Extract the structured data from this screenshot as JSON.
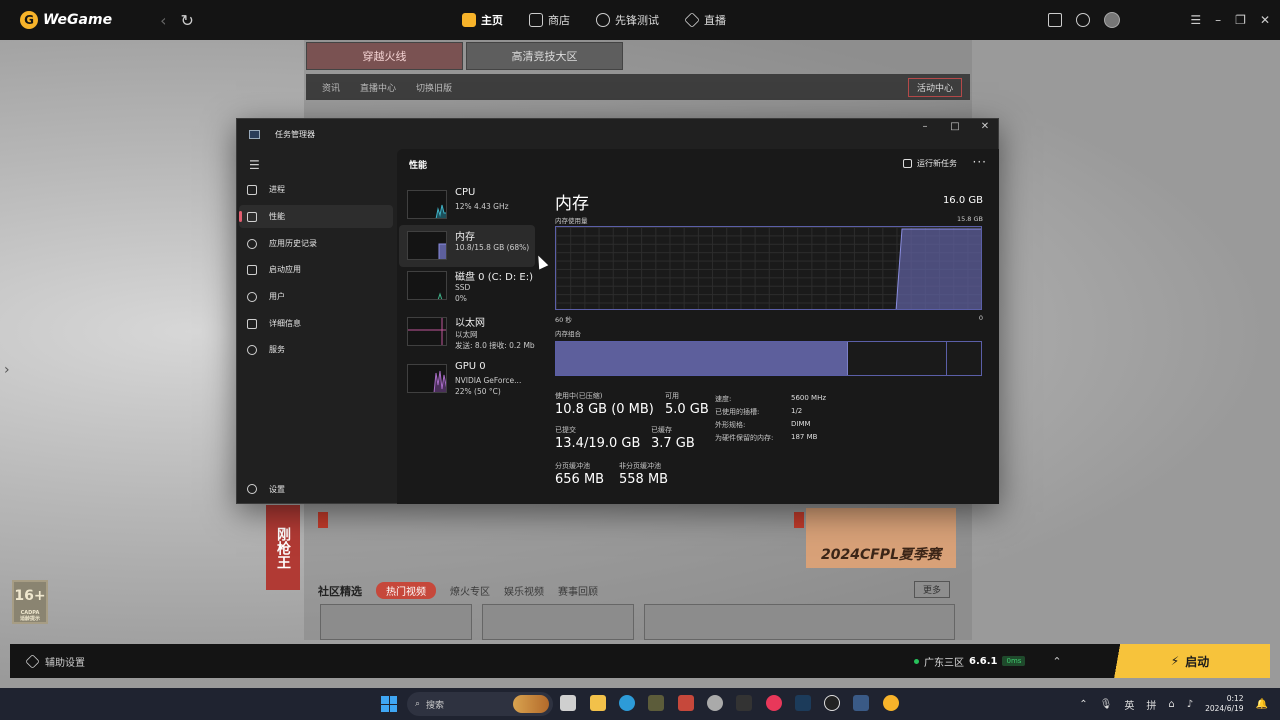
{
  "wegame": {
    "logo": "WeGame",
    "nav": [
      {
        "label": "主页",
        "icon": "home-icon",
        "active": true
      },
      {
        "label": "商店",
        "icon": "store-icon",
        "active": false
      },
      {
        "label": "先锋测试",
        "icon": "pioneer-icon",
        "active": false
      },
      {
        "label": "直播",
        "icon": "live-icon",
        "active": false
      }
    ],
    "game_tabs": [
      "穿越火线",
      "高清竞技大区"
    ],
    "sub_nav": [
      "资讯",
      "直播中心",
      "切换旧版"
    ],
    "activity_center": "活动中心",
    "banner_text": "刚枪王",
    "cfpl_text": "2024CFPL夏季赛",
    "community": {
      "heading": "社区精选",
      "tabs": [
        "热门视频",
        "燎火专区",
        "娱乐视频",
        "赛事回顾"
      ],
      "more": "更多"
    },
    "age_rating": "16+",
    "age_rating_sub": "CADPA",
    "age_hint": "适龄提示",
    "assist_label": "辅助设置",
    "server": {
      "name": "广东三区",
      "version": "6.6.1",
      "ping": "0ms"
    },
    "launch_label": "启动"
  },
  "task_manager": {
    "title": "任务管理器",
    "nav": [
      {
        "label": "进程",
        "icon": "processes-icon"
      },
      {
        "label": "性能",
        "icon": "performance-icon",
        "selected": true
      },
      {
        "label": "应用历史记录",
        "icon": "app-history-icon"
      },
      {
        "label": "启动应用",
        "icon": "startup-apps-icon"
      },
      {
        "label": "用户",
        "icon": "users-icon"
      },
      {
        "label": "详细信息",
        "icon": "details-icon"
      },
      {
        "label": "服务",
        "icon": "services-icon"
      }
    ],
    "settings_label": "设置",
    "header": "性能",
    "run_new_task": "运行新任务",
    "resources": [
      {
        "name": "CPU",
        "lines": [
          "12% 4.43 GHz"
        ]
      },
      {
        "name": "内存",
        "lines": [
          "10.8/15.8 GB (68%)"
        ],
        "selected": true
      },
      {
        "name": "磁盘 0 (C: D: E:)",
        "lines": [
          "SSD",
          "0%"
        ]
      },
      {
        "name": "以太网",
        "lines": [
          "以太网",
          "发送: 8.0 接收: 0.2 Mb"
        ]
      },
      {
        "name": "GPU 0",
        "lines": [
          "NVIDIA GeForce...",
          "22% (50 °C)"
        ]
      }
    ],
    "memory": {
      "title": "内存",
      "total": "16.0 GB",
      "usage_label": "内存使用量",
      "max_label": "15.8 GB",
      "time_left": "60 秒",
      "time_right": "0",
      "composition_label": "内存组合",
      "in_use_fraction": 0.687,
      "stats": [
        {
          "label": "使用中(已压缩)",
          "value": "10.8 GB (0 MB)"
        },
        {
          "label": "可用",
          "value": "5.0 GB"
        },
        {
          "label": "已提交",
          "value": "13.4/19.0 GB"
        },
        {
          "label": "已缓存",
          "value": "3.7 GB"
        },
        {
          "label": "分页缓冲池",
          "value": "656 MB"
        },
        {
          "label": "非分页缓冲池",
          "value": "558 MB"
        }
      ],
      "details": [
        {
          "label": "速度:",
          "value": "5600 MHz"
        },
        {
          "label": "已使用的插槽:",
          "value": "1/2"
        },
        {
          "label": "外形规格:",
          "value": "DIMM"
        },
        {
          "label": "为硬件保留的内存:",
          "value": "187 MB"
        }
      ]
    }
  },
  "taskbar": {
    "search_placeholder": "搜索",
    "ime_lang": "英",
    "ime_mode": "拼",
    "time": "0:12",
    "date": "2024/6/19"
  }
}
